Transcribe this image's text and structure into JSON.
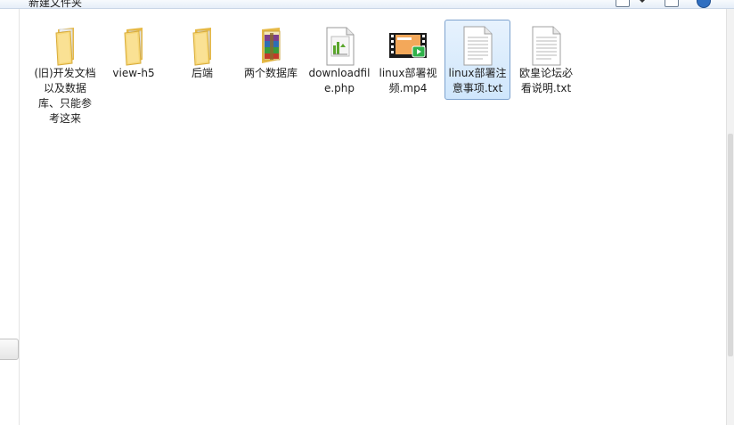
{
  "window": {
    "breadcrumb": "新建文件夹"
  },
  "files": [
    {
      "name": "(旧)开发文档以及数据库、只能参考这来",
      "type": "folder-doc",
      "icon": "folder-icon"
    },
    {
      "name": "view-h5",
      "type": "folder",
      "icon": "folder-icon"
    },
    {
      "name": "后端",
      "type": "folder",
      "icon": "folder-icon"
    },
    {
      "name": "两个数据库",
      "type": "archive",
      "icon": "winrar-archive-icon"
    },
    {
      "name": "downloadfile.php",
      "type": "php",
      "icon": "php-file-icon"
    },
    {
      "name": "linux部署视频.mp4",
      "type": "video",
      "icon": "video-file-icon"
    },
    {
      "name": "linux部署注意事项.txt",
      "type": "txt",
      "icon": "text-file-icon",
      "selected": true
    },
    {
      "name": "欧皇论坛必看说明.txt",
      "type": "txt",
      "icon": "text-file-icon"
    }
  ],
  "colors": {
    "selection_bg": "#cfe6fc",
    "selection_border": "#7da2ce",
    "folder": "#f2cf6a"
  }
}
